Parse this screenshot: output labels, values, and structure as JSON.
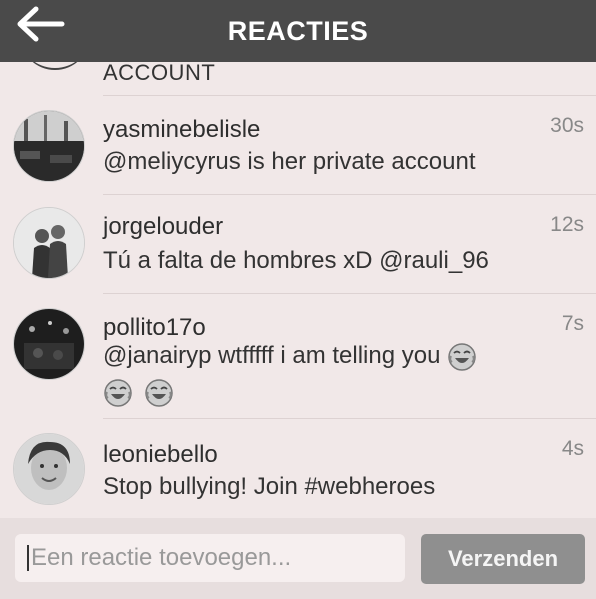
{
  "header": {
    "title": "REACTIES",
    "back_icon": "arrow-left-icon"
  },
  "partial_comment": {
    "text": "ACCOUNT"
  },
  "comments": [
    {
      "username": "yasminebelisle",
      "text": "@meliycyrus is her private account",
      "time": "30s"
    },
    {
      "username": "jorgelouder",
      "text": "Tú a falta de hombres xD @rauli_96",
      "time": "12s"
    },
    {
      "username": "pollito17o",
      "text": "@janairyp wtfffff i am telling you",
      "time": "7s",
      "emojis": [
        "tears-of-joy-emoji",
        "tears-of-joy-emoji",
        "tears-of-joy-emoji"
      ]
    },
    {
      "username": "leoniebello",
      "text": "Stop bullying! Join #webheroes",
      "time": "4s"
    }
  ],
  "composer": {
    "placeholder": "Een reactie toevoegen...",
    "send_label": "Verzenden"
  },
  "colors": {
    "header_bg": "#4a4a4a",
    "page_bg": "#f1e8e8",
    "send_bg": "#8f8f8f"
  }
}
